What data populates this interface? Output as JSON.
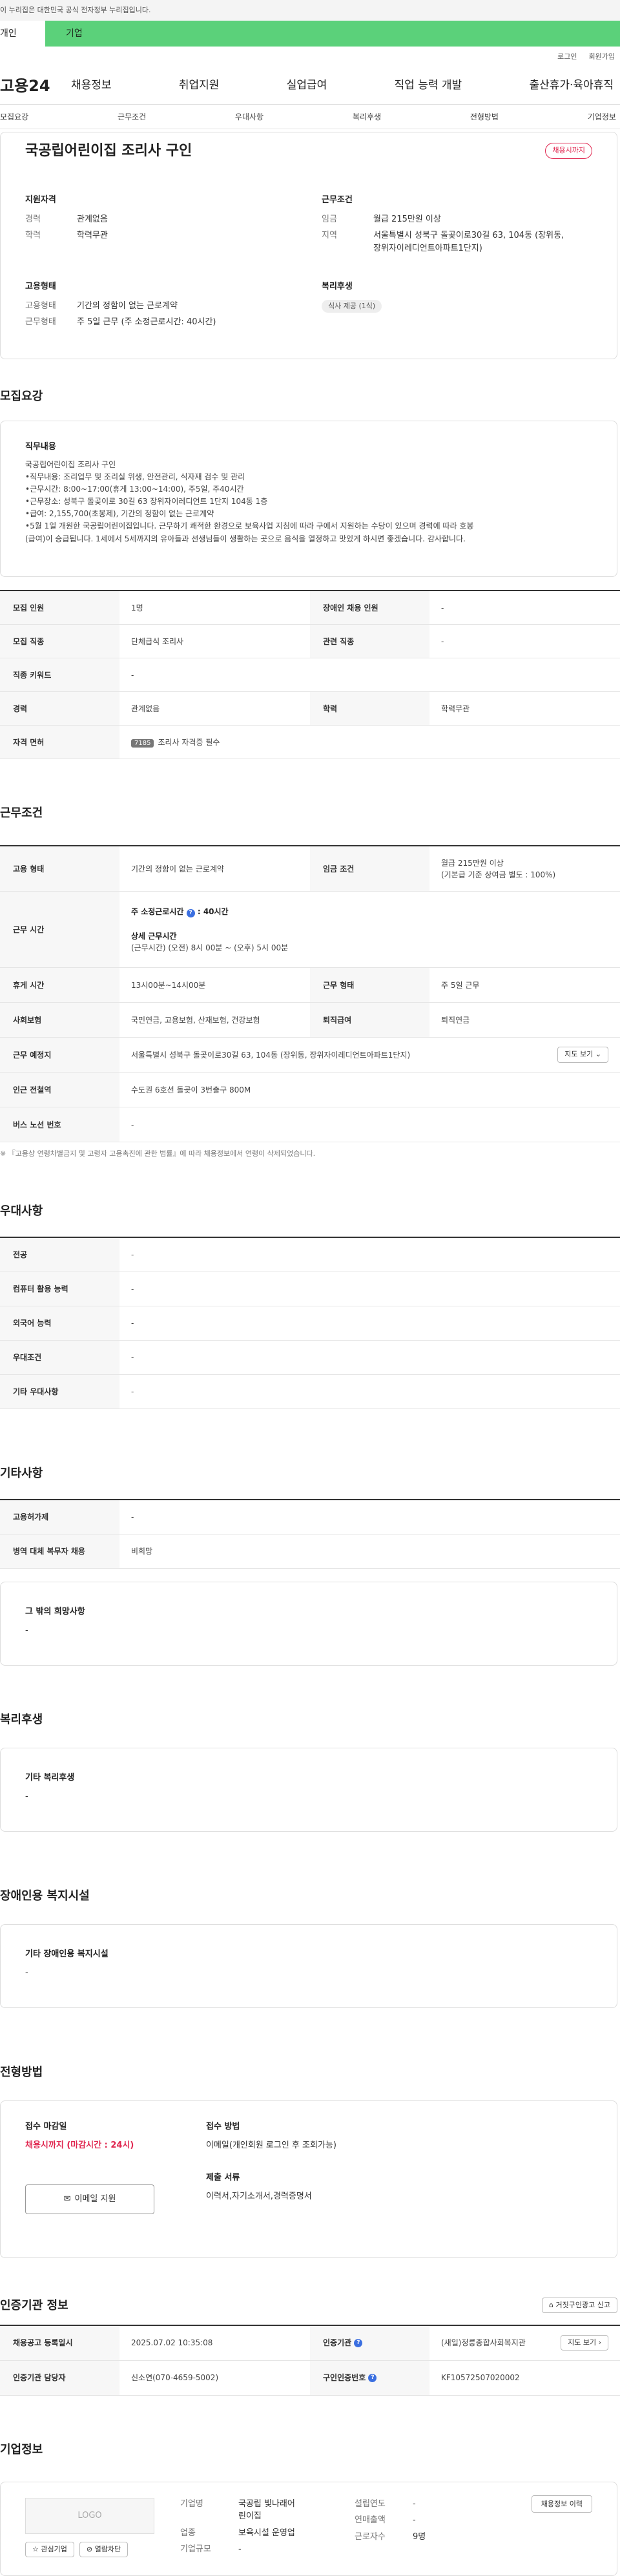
{
  "gov_banner": "이 누리집은 대한민국 공식 전자정부 누리집입니다.",
  "top_tabs": [
    "개인",
    "기업"
  ],
  "util_links": [
    "로그인",
    "회원가입"
  ],
  "logo": "고용24",
  "gnb": [
    "채용정보",
    "취업지원",
    "실업급여",
    "직업 능력 개발",
    "출산휴가·육아휴직"
  ],
  "anchor_tabs": [
    "모집요강",
    "근무조건",
    "우대사항",
    "복리후생",
    "전형방법",
    "기업정보"
  ],
  "job": {
    "title": "국공립어린이집 조리사 구인",
    "status": "채용시까지"
  },
  "summary": {
    "qual_h": "지원자격",
    "career_k": "경력",
    "career_v": "관계없음",
    "edu_k": "학력",
    "edu_v": "학력무관",
    "type_h": "고용형태",
    "type_k": "고용형태",
    "type_v": "기간의 정함이 없는 근로계약",
    "hours_k": "근무형태",
    "hours_v": "주 5일 근무 (주 소정근로시간: 40시간)",
    "cond_h": "근무조건",
    "wage_k": "임금",
    "wage_v": "월급 215만원 이상",
    "area_k": "지역",
    "area_v1": "서울특별시 성북구 돌곶이로30길 63, 104동 (장위동,",
    "area_v2": "장위자이레디언트아파트1단지)",
    "welfare_h": "복리후생",
    "welfare_chip": "식사 제공 (1식)"
  },
  "recruit": {
    "title": "모집요강",
    "duty_h": "직무내용",
    "duty_lines": [
      "국공립어린이집 조리사 구인",
      "•직무내용: 조리업무 및 조리실 위생, 안전관리, 식자재 검수 및 관리",
      "•근무시간: 8:00~17:00(휴게 13:00~14:00), 주5일, 주40시간",
      "•근무장소: 성북구 돌곶이로 30길 63 장위자이레디언트 1단지 104동 1층",
      "•급여: 2,155,700(초봉제), 기간의 정함이 없는 근로계약",
      "•5월 1일 개원한 국공립어린이집입니다. 근무하기 쾌적한 환경으로 보육사업 지침에 따라 구에서 지원하는 수당이 있으며 경력에 따라 호봉",
      "(급여)이 승급됩니다. 1세에서 5세까지의 유아들과 선생님들이 생활하는 곳으로 음식을 열정하고 맛있게 하시면 좋겠습니다. 감사합니다."
    ],
    "rows": [
      [
        "모집 인원",
        "1명",
        "장애인 채용 인원",
        "-"
      ],
      [
        "모집 직종",
        "단체급식 조리사",
        "관련 직종",
        "-"
      ]
    ],
    "keyword_k": "직종 키워드",
    "keyword_v": "-",
    "career_k": "경력",
    "career_v": "관계없음",
    "edu_k": "학력",
    "edu_v": "학력무관",
    "license_k": "자격 면허",
    "license_tag": "7185",
    "license_v": "조리사 자격증 필수"
  },
  "work": {
    "title": "근무조건",
    "type_k": "고용 형태",
    "type_v": "기간의 정함이 없는 근로계약",
    "wage_k": "임금 조건",
    "wage_v1": "월급 215만원 이상",
    "wage_v2": "(기본급 기준 상여금 별도 : 100%)",
    "time_k": "근무 시간",
    "time_weekly": "주 소정근로시간",
    "time_weekly_v": ": 40시간",
    "time_detail_h": "상세 근무시간",
    "time_detail_v": "(근무시간) (오전) 8시 00분 ~ (오후) 5시 00분",
    "rest_k": "휴게 시간",
    "rest_v": "13시00분~14시00분",
    "shape_k": "근무 형태",
    "shape_v": "주 5일 근무",
    "ins_k": "사회보험",
    "ins_v": "국민연금, 고용보험, 산재보험, 건강보험",
    "ret_k": "퇴직급여",
    "ret_v": "퇴직연금",
    "place_k": "근무 예정지",
    "place_v": "서울특별시 성북구 돌곶이로30길 63, 104동 (장위동, 장위자이레디언트아파트1단지)",
    "map_btn": "지도 보기",
    "subway_k": "인근 전철역",
    "subway_v": "수도권 6호선 돌곶이 3번출구 800M",
    "bus_k": "버스 노선 번호",
    "bus_v": "-",
    "note": "※ 『고용상 연령차별금지 및 고령자 고용촉진에 관한 법률』에 따라 채용정보에서 연령이 삭제되었습니다."
  },
  "pref": {
    "title": "우대사항",
    "rows": [
      [
        "전공",
        "-"
      ],
      [
        "컴퓨터 활용 능력",
        "-"
      ],
      [
        "외국어 능력",
        "-"
      ],
      [
        "우대조건",
        "-"
      ],
      [
        "기타 우대사항",
        "-"
      ]
    ]
  },
  "etc": {
    "title": "기타사항",
    "rows": [
      [
        "고용허가제",
        "-"
      ],
      [
        "병역 대체 복무자 채용",
        "비희망"
      ]
    ],
    "hope_h": "그 밖의 희망사항",
    "hope_v": "-"
  },
  "welfare": {
    "title": "복리후생",
    "h": "기타 복리후생",
    "v": "-"
  },
  "disabled": {
    "title": "장애인용 복지시설",
    "h": "기타 장애인용 복지시설",
    "v": "-"
  },
  "apply": {
    "title": "전형방법",
    "deadline_h": "접수 마감일",
    "deadline_v": "채용시까지 (마감시간 : 24시)",
    "email_btn": "이메일 지원",
    "method_h": "접수 방법",
    "method_v": "이메일(개인회원 로그인 후 조회가능)",
    "docs_h": "제출 서류",
    "docs_v": "이력서,자기소개서,경력증명서"
  },
  "agency": {
    "title": "인증기관 정보",
    "report_btn": "거짓구인광고 신고",
    "reg_k": "채용공고 등록일시",
    "reg_v": "2025.07.02 10:35:08",
    "org_k": "인증기관",
    "org_v": "(새일)정릉종합사회복지관",
    "org_btn": "지도 보기",
    "mgr_k": "인증기관 담당자",
    "mgr_v": "신소연(070-4659-5002)",
    "no_k": "구인인증번호",
    "no_v": "KF10572507020002"
  },
  "company": {
    "title": "기업정보",
    "logo": "LOGO",
    "fav_btn": "관심기업",
    "block_btn": "열람차단",
    "name_k": "기업명",
    "name_v1": "국공립 빛나래어",
    "name_v2": "린이집",
    "ind_k": "업종",
    "ind_v": "보육시설 운영업",
    "size_k": "기업규모",
    "size_v": "-",
    "year_k": "설립연도",
    "year_v": "-",
    "sales_k": "연매출액",
    "sales_v": "-",
    "emp_k": "근로자수",
    "emp_v": "9명",
    "history_btn": "채용정보 이력"
  },
  "colors": {
    "brand_green": "#5bd17a",
    "accent_red": "#e0264f",
    "info_blue": "#3b6fe0"
  }
}
